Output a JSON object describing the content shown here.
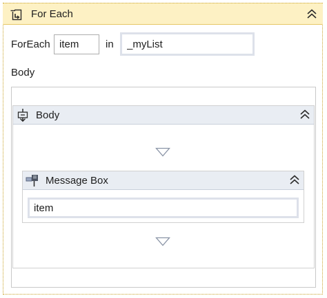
{
  "foreach": {
    "title": "For Each",
    "foreach_label": "ForEach",
    "item_value": "item",
    "in_label": "in",
    "list_value": "_myList",
    "body_label": "Body"
  },
  "sequence": {
    "title": "Body"
  },
  "message_box": {
    "title": "Message Box",
    "text_value": "item"
  },
  "colors": {
    "foreach_header_bg": "#fdf1c4",
    "activity_header_bg": "#e9edf3",
    "outer_border": "#c9a227"
  },
  "icons": {
    "foreach": "foreach-loop-icon",
    "sequence": "sequence-icon",
    "message_box": "message-box-icon",
    "collapse": "collapse-chevrons-icon",
    "drop_target": "drop-arrow-icon"
  }
}
